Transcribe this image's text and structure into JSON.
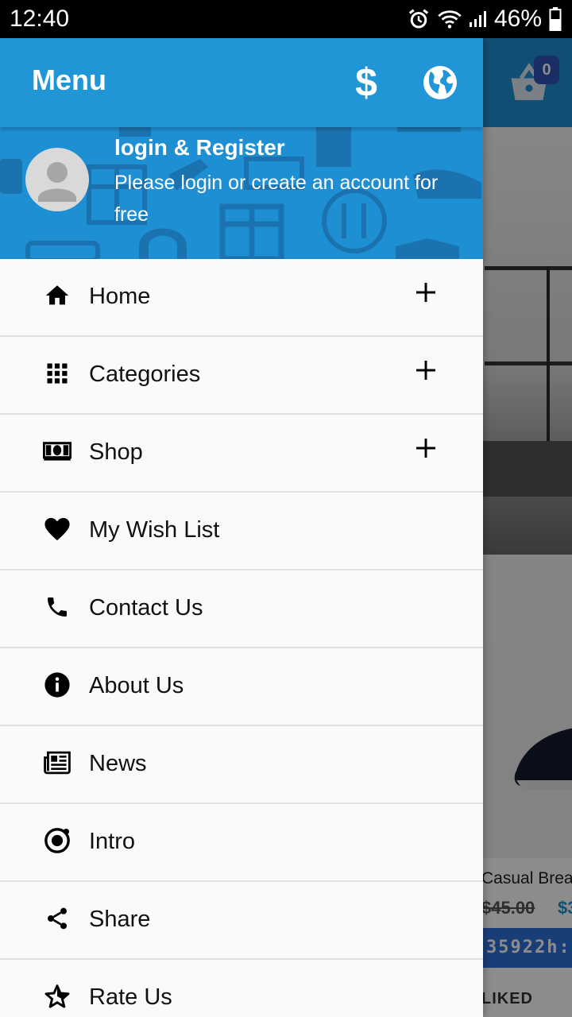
{
  "status_bar": {
    "time": "12:40",
    "battery": "46%"
  },
  "background": {
    "cart_badge": "0",
    "product_title": "Casual Brea",
    "old_price": "$45.00",
    "new_price": "$3",
    "timer": "35922h:",
    "liked_label": "LIKED"
  },
  "drawer": {
    "title": "Menu",
    "currency_symbol": "$",
    "header": {
      "title": "login & Register",
      "subtitle": "Please login or create an account for free"
    },
    "items": [
      {
        "label": "Home",
        "icon": "home-icon",
        "expandable": true
      },
      {
        "label": "Categories",
        "icon": "grid-icon",
        "expandable": true
      },
      {
        "label": "Shop",
        "icon": "money-icon",
        "expandable": true
      },
      {
        "label": "My Wish List",
        "icon": "heart-icon",
        "expandable": false
      },
      {
        "label": "Contact Us",
        "icon": "phone-icon",
        "expandable": false
      },
      {
        "label": "About Us",
        "icon": "info-icon",
        "expandable": false
      },
      {
        "label": "News",
        "icon": "newspaper-icon",
        "expandable": false
      },
      {
        "label": "Intro",
        "icon": "intro-icon",
        "expandable": false
      },
      {
        "label": "Share",
        "icon": "share-icon",
        "expandable": false
      },
      {
        "label": "Rate Us",
        "icon": "star-icon",
        "expandable": false
      }
    ]
  },
  "colors": {
    "primary": "#2196d6",
    "header_bg": "#1f8fd3",
    "badge": "#3052b8"
  }
}
